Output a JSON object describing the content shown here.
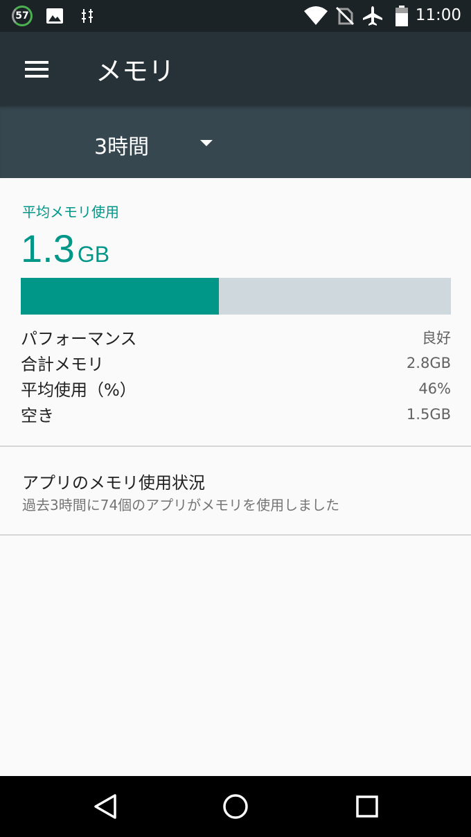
{
  "status_bar": {
    "badge": "57",
    "time": "11:00",
    "icons": [
      "circle-57-icon",
      "image-icon",
      "usb-debug-icon",
      "wifi-icon",
      "no-sim-icon",
      "airplane-icon",
      "battery-icon"
    ]
  },
  "app_bar": {
    "title": "メモリ",
    "menu_icon": "hamburger-menu-icon"
  },
  "period_selector": {
    "selected": "3時間"
  },
  "summary": {
    "label": "平均メモリ使用",
    "value": "1.3",
    "unit": "GB",
    "usage_fraction": 0.46,
    "colors": {
      "accent": "#009688",
      "track": "#cfd8dc"
    }
  },
  "stats": [
    {
      "label": "パフォーマンス",
      "value": "良好"
    },
    {
      "label": "合計メモリ",
      "value": "2.8GB"
    },
    {
      "label": "平均使用（%）",
      "value": "46%"
    },
    {
      "label": "空き",
      "value": "1.5GB"
    }
  ],
  "app_usage": {
    "title": "アプリのメモリ使用状況",
    "subtitle": "過去3時間に74個のアプリがメモリを使用しました"
  },
  "nav_bar": {
    "icons": [
      "back-icon",
      "home-icon",
      "recents-icon"
    ]
  }
}
